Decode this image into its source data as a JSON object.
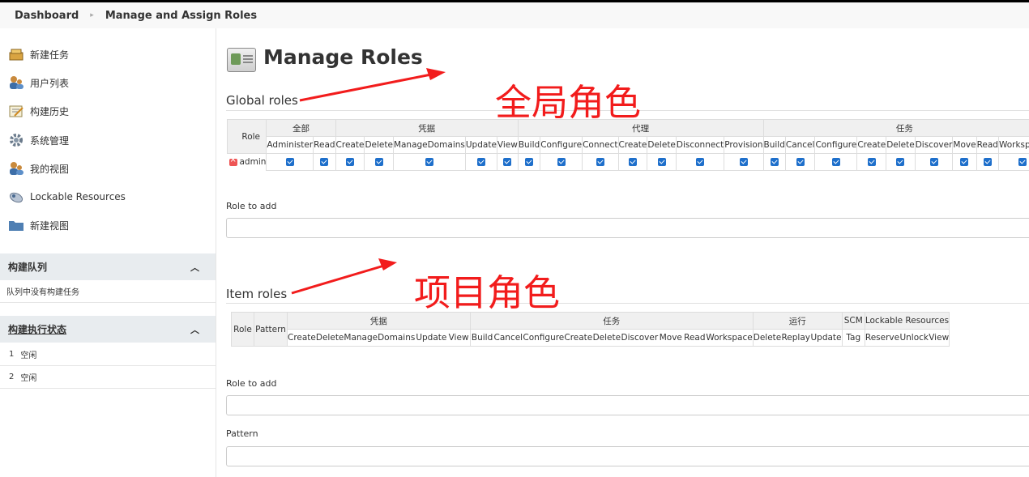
{
  "breadcrumb": {
    "items": [
      "Dashboard",
      "Manage and Assign Roles"
    ]
  },
  "sidebar": {
    "tasks": [
      {
        "label": "新建任务",
        "icon": "new-item-icon"
      },
      {
        "label": "用户列表",
        "icon": "users-icon"
      },
      {
        "label": "构建历史",
        "icon": "build-history-icon"
      },
      {
        "label": "系统管理",
        "icon": "gear-icon"
      },
      {
        "label": "我的视图",
        "icon": "users-icon"
      },
      {
        "label": "Lockable Resources",
        "icon": "lockable-resources-icon"
      },
      {
        "label": "新建视图",
        "icon": "folder-icon"
      }
    ],
    "build_queue": {
      "title": "构建队列",
      "empty_text": "队列中没有构建任务"
    },
    "executors": {
      "title": "构建执行状态",
      "items": [
        {
          "num": "1",
          "status": "空闲"
        },
        {
          "num": "2",
          "status": "空闲"
        }
      ]
    }
  },
  "main": {
    "title": "Manage Roles",
    "global_roles": {
      "title": "Global roles",
      "annotation": "全局角色",
      "role_header": "Role",
      "groups": [
        {
          "name": "全部",
          "perms": [
            "Administer",
            "Read"
          ]
        },
        {
          "name": "凭据",
          "perms": [
            "Create",
            "Delete",
            "ManageDomains",
            "Update",
            "View"
          ]
        },
        {
          "name": "代理",
          "perms": [
            "Build",
            "Configure",
            "Connect",
            "Create",
            "Delete",
            "Disconnect",
            "Provision"
          ]
        },
        {
          "name": "任务",
          "perms": [
            "Build",
            "Cancel",
            "Configure",
            "Create",
            "Delete",
            "Discover",
            "Move",
            "Read",
            "Workspace"
          ]
        }
      ],
      "rows": [
        {
          "role": "admin"
        }
      ],
      "role_to_add_label": "Role to add"
    },
    "item_roles": {
      "title": "Item roles",
      "annotation": "项目角色",
      "role_header": "Role",
      "pattern_header": "Pattern",
      "groups": [
        {
          "name": "凭据",
          "perms": [
            "Create",
            "Delete",
            "ManageDomains",
            "Update",
            "View"
          ]
        },
        {
          "name": "任务",
          "perms": [
            "Build",
            "Cancel",
            "Configure",
            "Create",
            "Delete",
            "Discover",
            "Move",
            "Read",
            "Workspace"
          ]
        },
        {
          "name": "运行",
          "perms": [
            "Delete",
            "Replay",
            "Update"
          ]
        },
        {
          "name": "SCM",
          "perms": [
            "Tag"
          ]
        },
        {
          "name": "Lockable Resources",
          "perms": [
            "Reserve",
            "Unlock",
            "View"
          ]
        }
      ],
      "role_to_add_label": "Role to add",
      "pattern_label": "Pattern"
    }
  },
  "colors": {
    "annotation": "#f21c1c",
    "checkbox": "#1e6fcb"
  }
}
